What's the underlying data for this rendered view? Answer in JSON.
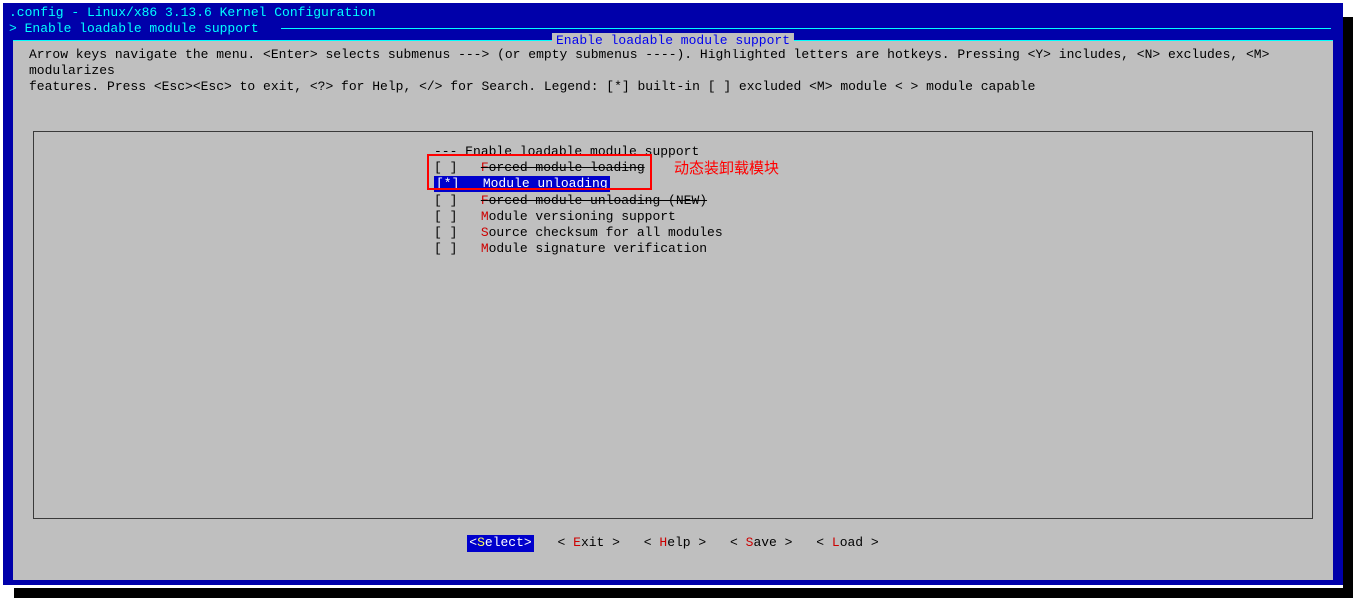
{
  "titlebar": ".config - Linux/x86 3.13.6 Kernel Configuration",
  "breadcrumb": "> Enable loadable module support ",
  "dialog_title": "Enable loadable module support",
  "help_line1": "Arrow keys navigate the menu.  <Enter> selects submenus ---> (or empty submenus ----).  Highlighted letters are hotkeys.  Pressing <Y> includes, <N> excludes, <M> modularizes",
  "help_line2": "features.  Press <Esc><Esc> to exit, <?> for Help, </> for Search.  Legend: [*] built-in  [ ] excluded  <M> module  < > module capable",
  "menu": {
    "items": [
      {
        "marker": "---",
        "text": "Enable loadable module support",
        "hotkey": "",
        "strike": false,
        "selected": false
      },
      {
        "marker": "[ ]",
        "text": "orced module loading",
        "hotkey": "F",
        "strike": true,
        "selected": false
      },
      {
        "marker": "[*]",
        "text": "odule unloading",
        "hotkey": "M",
        "strike": false,
        "selected": true
      },
      {
        "marker": "[ ]",
        "text": "orced module unloading (NEW)",
        "hotkey": "F",
        "strike": true,
        "selected": false
      },
      {
        "marker": "[ ]",
        "text": "odule versioning support",
        "hotkey": "M",
        "strike": false,
        "selected": false
      },
      {
        "marker": "[ ]",
        "text": "ource checksum for all modules",
        "hotkey": "S",
        "strike": false,
        "selected": false
      },
      {
        "marker": "[ ]",
        "text": "odule signature verification",
        "hotkey": "M",
        "strike": false,
        "selected": false
      }
    ]
  },
  "annotation": "动态装卸载模块",
  "buttons": {
    "select": {
      "pre": "<",
      "hotkey": "S",
      "rest": "elect>",
      "active": true
    },
    "exit": {
      "pre": "< ",
      "hotkey": "E",
      "rest": "xit >",
      "active": false
    },
    "help": {
      "pre": "< ",
      "hotkey": "H",
      "rest": "elp >",
      "active": false
    },
    "save": {
      "pre": "< ",
      "hotkey": "S",
      "rest": "ave >",
      "active": false
    },
    "load": {
      "pre": "< ",
      "hotkey": "L",
      "rest": "oad >",
      "active": false
    }
  }
}
